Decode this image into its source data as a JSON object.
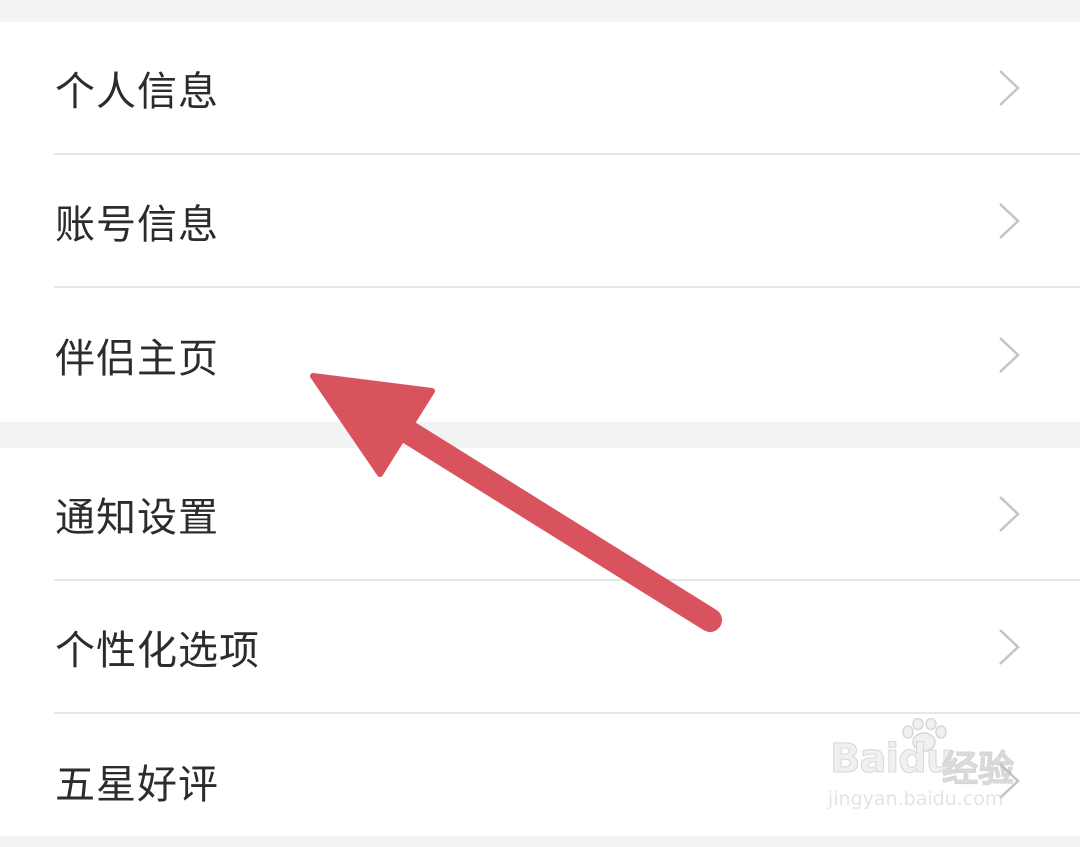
{
  "settings": {
    "group1": [
      {
        "label": "个人信息"
      },
      {
        "label": "账号信息"
      },
      {
        "label": "伴侣主页"
      }
    ],
    "group2": [
      {
        "label": "通知设置"
      },
      {
        "label": "个性化选项"
      },
      {
        "label": "五星好评"
      }
    ]
  },
  "annotation": {
    "arrow_color": "#d9535e",
    "target": "伴侣主页"
  },
  "watermark": {
    "brand": "Baidu",
    "text": "经验",
    "url": "jingyan.baidu.com"
  },
  "colors": {
    "background": "#f3f3f3",
    "row_background": "#ffffff",
    "separator": "#e6e6e6",
    "text": "#2c2c2c",
    "chevron": "#c4c4c4"
  }
}
